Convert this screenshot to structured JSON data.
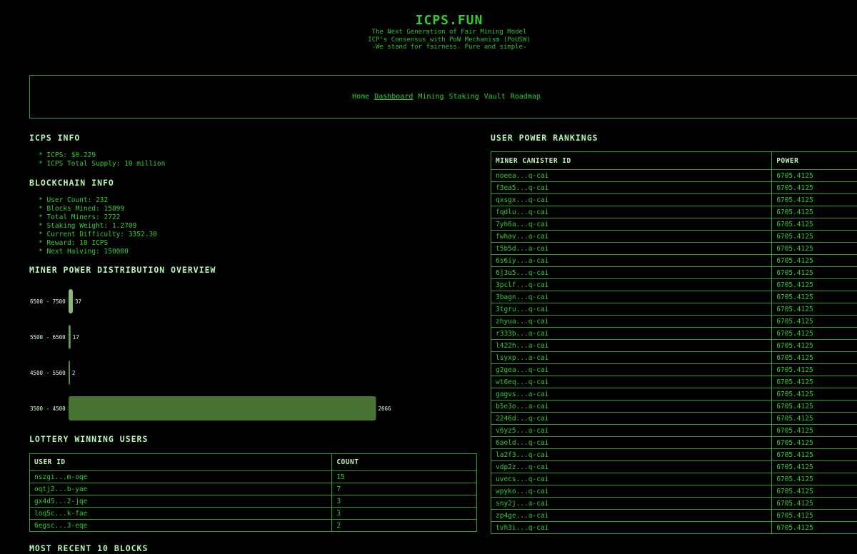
{
  "header": {
    "title": "ICPS.FUN",
    "taglines": [
      "The Next Generation of Fair Mining Model",
      "ICP's Consensus with PoW Mechanism (PoUSW)",
      "-We stand for fairness. Pure and simple-"
    ]
  },
  "nav": {
    "items": [
      "Home",
      "Dashboard",
      "Mining",
      "Staking",
      "Vault",
      "Roadmap"
    ],
    "active": "Dashboard"
  },
  "icps_info": {
    "title": "ICPS INFO",
    "items": [
      "ICPS: $0.229",
      "ICPS Total Supply: 10 million"
    ]
  },
  "blockchain_info": {
    "title": "BLOCKCHAIN INFO",
    "items": [
      "User Count: 232",
      "Blocks Mined: 15899",
      "Total Miners: 2722",
      "Staking Weight: 1.2709",
      "Current Difficulty: 3352.30",
      "Reward: 10 ICPS",
      "Next Halving: 150000"
    ]
  },
  "distribution": {
    "title": "MINER POWER DISTRIBUTION OVERVIEW"
  },
  "chart_data": {
    "type": "bar",
    "orientation": "horizontal",
    "categories": [
      "6500 - 7500",
      "5500 - 6500",
      "4500 - 5500",
      "3500 - 4500"
    ],
    "values": [
      37,
      17,
      2,
      2666
    ],
    "colors": [
      "#8cb87a",
      "#6f9c5e",
      "#5c8a4c",
      "#487334"
    ],
    "xlim": [
      0,
      2700
    ],
    "title": "",
    "xlabel": "",
    "ylabel": "",
    "grid": false
  },
  "lottery": {
    "title": "LOTTERY WINNING USERS",
    "headers": [
      "USER ID",
      "COUNT"
    ],
    "rows": [
      [
        "nszgi...m-oqe",
        "15"
      ],
      [
        "oqtj2...b-yae",
        "7"
      ],
      [
        "gx4d5...2-jqe",
        "3"
      ],
      [
        "loq5c...k-fae",
        "3"
      ],
      [
        "6egsc...3-eqe",
        "2"
      ]
    ]
  },
  "recent_blocks": {
    "title": "MOST RECENT 10 BLOCKS"
  },
  "rankings": {
    "title": "USER POWER RANKINGS",
    "headers": [
      "MINER CANISTER ID",
      "POWER"
    ],
    "rows": [
      [
        "noeea...q-cai",
        "6705.4125"
      ],
      [
        "f3ea5...q-cai",
        "6705.4125"
      ],
      [
        "qxsgx...q-cai",
        "6705.4125"
      ],
      [
        "fqdlu...q-cai",
        "6705.4125"
      ],
      [
        "7yh6a...q-cai",
        "6705.4125"
      ],
      [
        "fwhav...a-cai",
        "6705.4125"
      ],
      [
        "t5b5d...a-cai",
        "6705.4125"
      ],
      [
        "6s6iy...a-cai",
        "6705.4125"
      ],
      [
        "6j3u5...q-cai",
        "6705.4125"
      ],
      [
        "3pclf...q-cai",
        "6705.4125"
      ],
      [
        "3bagn...q-cai",
        "6705.4125"
      ],
      [
        "3tgru...q-cai",
        "6705.4125"
      ],
      [
        "zhyua...q-cai",
        "6705.4125"
      ],
      [
        "r333b...a-cai",
        "6705.4125"
      ],
      [
        "l422h...a-cai",
        "6705.4125"
      ],
      [
        "lsyxp...a-cai",
        "6705.4125"
      ],
      [
        "g2gea...q-cai",
        "6705.4125"
      ],
      [
        "wt6eq...q-cai",
        "6705.4125"
      ],
      [
        "gagvs...a-cai",
        "6705.4125"
      ],
      [
        "b5e3o...a-cai",
        "6705.4125"
      ],
      [
        "2246d...q-cai",
        "6705.4125"
      ],
      [
        "v6yz5...a-cai",
        "6705.4125"
      ],
      [
        "6aold...q-cai",
        "6705.4125"
      ],
      [
        "la2f3...q-cai",
        "6705.4125"
      ],
      [
        "vdp2z...q-cai",
        "6705.4125"
      ],
      [
        "uvecs...q-cai",
        "6705.4125"
      ],
      [
        "wpyko...q-cai",
        "6705.4125"
      ],
      [
        "sny2j...a-cai",
        "6705.4125"
      ],
      [
        "zp4ge...a-cai",
        "6705.4125"
      ],
      [
        "tvh3i...q-cai",
        "6705.4125"
      ]
    ]
  }
}
